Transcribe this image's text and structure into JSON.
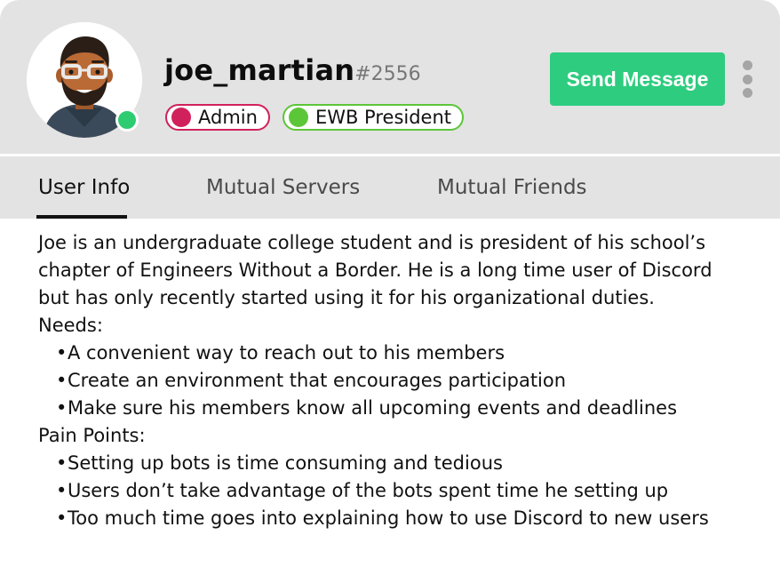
{
  "profile": {
    "username": "joe_martian",
    "discriminator": "#2556",
    "status": "online",
    "status_color": "#2ecc71",
    "avatar_icon": "bearded-man-glasses-avatar"
  },
  "roles": [
    {
      "label": "Admin",
      "color": "#d1215c"
    },
    {
      "label": "EWB President",
      "color": "#5cc639"
    }
  ],
  "actions": {
    "send_message_label": "Send Message",
    "send_message_color": "#2ecc7f",
    "more_icon": "vertical-ellipsis-icon"
  },
  "tabs": [
    {
      "label": "User Info",
      "active": true
    },
    {
      "label": "Mutual Servers",
      "active": false
    },
    {
      "label": "Mutual Friends",
      "active": false
    }
  ],
  "user_info": {
    "bio": "Joe is an undergraduate college student and is president of his school’s chapter of Engineers Without a Border. He is a long time user of Discord but has only recently started using it for his organizational duties.",
    "needs_title": "Needs:",
    "needs": [
      "A convenient way to reach out to his members",
      "Create an environment that encourages participation",
      "Make sure his members know all upcoming events and deadlines"
    ],
    "pain_points_title": "Pain Points:",
    "pain_points": [
      "Setting up bots is time consuming and tedious",
      "Users don’t take advantage of the bots spent time he setting up",
      "Too much time goes into explaining how to use Discord to new users"
    ]
  }
}
